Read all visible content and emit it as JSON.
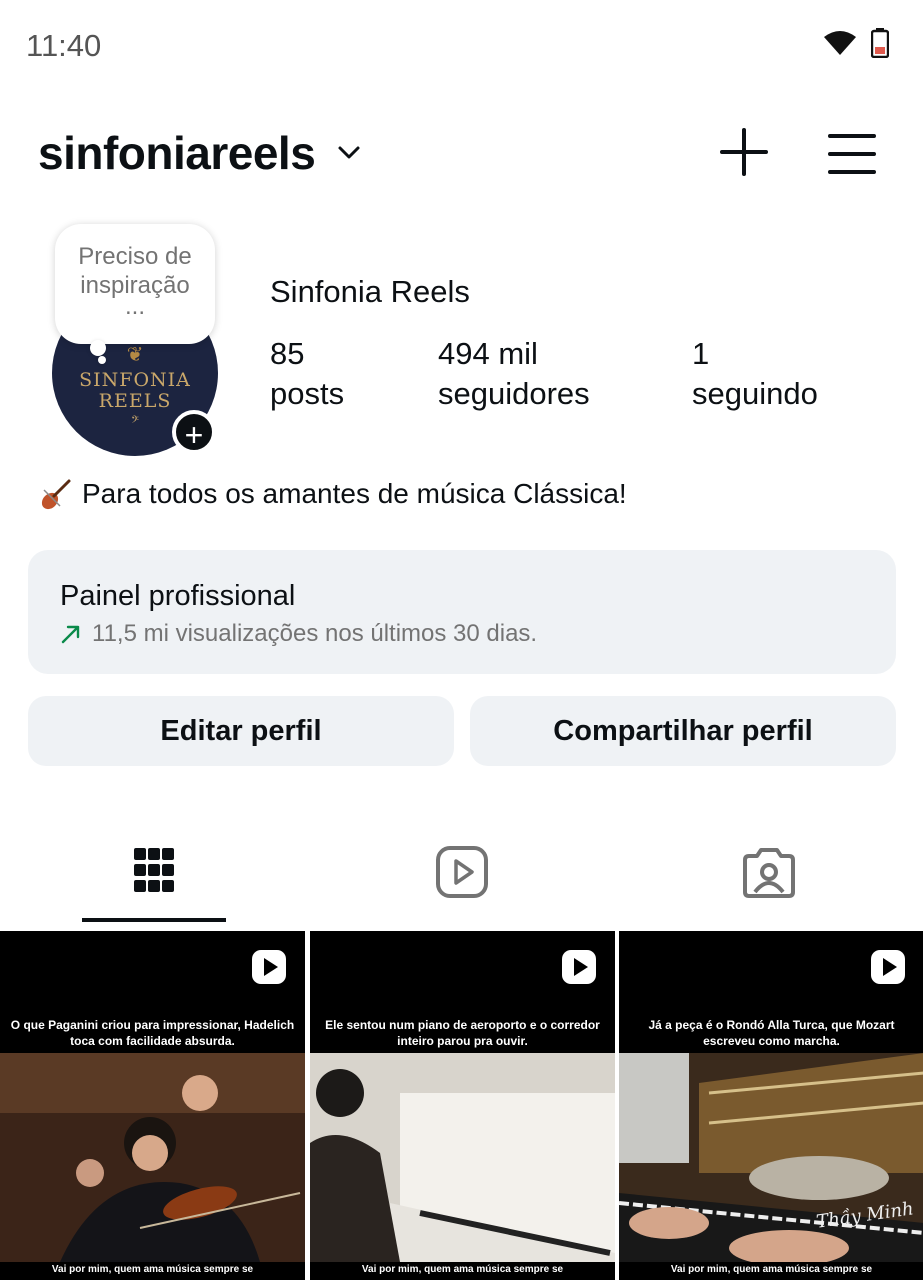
{
  "status_bar": {
    "time": "11:40"
  },
  "header": {
    "username": "sinfoniareels"
  },
  "note": {
    "line1": "Preciso de",
    "line2": "inspiração",
    "line3": "..."
  },
  "avatar": {
    "line1": "SINFONIA",
    "line2": "REELS"
  },
  "profile": {
    "display_name": "Sinfonia Reels",
    "stats": [
      {
        "value": "85",
        "label": "posts"
      },
      {
        "value": "494 mil",
        "label": "seguidores"
      },
      {
        "value": "1",
        "label": "seguindo"
      }
    ],
    "bio": "Para todos os amantes de música Clássica!"
  },
  "dashboard": {
    "title": "Painel profissional",
    "subtitle": "11,5 mi visualizações nos últimos 30 dias."
  },
  "buttons": {
    "edit": "Editar perfil",
    "share": "Compartilhar perfil"
  },
  "colors": {
    "accent_green": "#0a8a4a",
    "panel_bg": "#eff2f5"
  },
  "posts": [
    {
      "caption": "O que Paganini criou para impressionar, Hadelich toca com facilidade absurda.",
      "footer": "Vai por mim, quem ama música sempre se"
    },
    {
      "caption": "Ele sentou num piano de aeroporto e o corredor inteiro parou pra ouvir.",
      "footer": "Vai por mim, quem ama música sempre se"
    },
    {
      "caption": "Já a peça é o Rondó Alla Turca, que Mozart escreveu como marcha.",
      "footer": "Vai por mim, quem ama música sempre se",
      "watermark": "Thầy Minh"
    }
  ]
}
